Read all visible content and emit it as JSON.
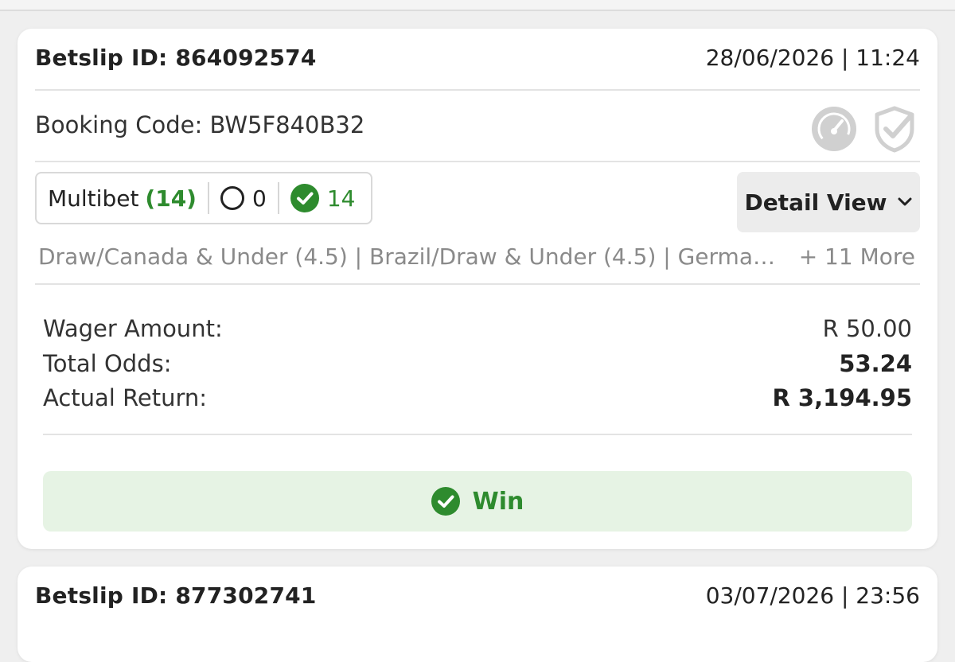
{
  "cards": [
    {
      "betslip_id_label": "Betslip ID: 864092574",
      "datetime": "28/06/2026 | 11:24",
      "booking_code": "Booking Code: BW5F840B32",
      "bet_type": "Multibet",
      "legs_count": "(14)",
      "open_count": "0",
      "won_count": "14",
      "detail_label": "Detail View",
      "selections": "Draw/Canada & Under (4.5) | Brazil/Draw & Under (4.5) | Germa…",
      "more_label": "+ 11 More",
      "summary": [
        {
          "label": "Wager Amount:",
          "value": "R 50.00"
        },
        {
          "label": "Total Odds:",
          "value": "53.24"
        },
        {
          "label": "Actual Return:",
          "value": "R 3,194.95"
        }
      ],
      "result": "Win"
    },
    {
      "betslip_id_label": "Betslip ID: 877302741",
      "datetime": "03/07/2026 | 23:56"
    }
  ],
  "icons": [
    "speedometer-icon",
    "shield-check-icon",
    "chevron-down-icon",
    "check-circle-icon",
    "circle-outline-icon"
  ],
  "colors": {
    "accent_green": "#2e8b2e",
    "win_bg": "#e6f3e4",
    "muted": "#8a8a8a",
    "icon_gray": "#d0d0d0"
  }
}
